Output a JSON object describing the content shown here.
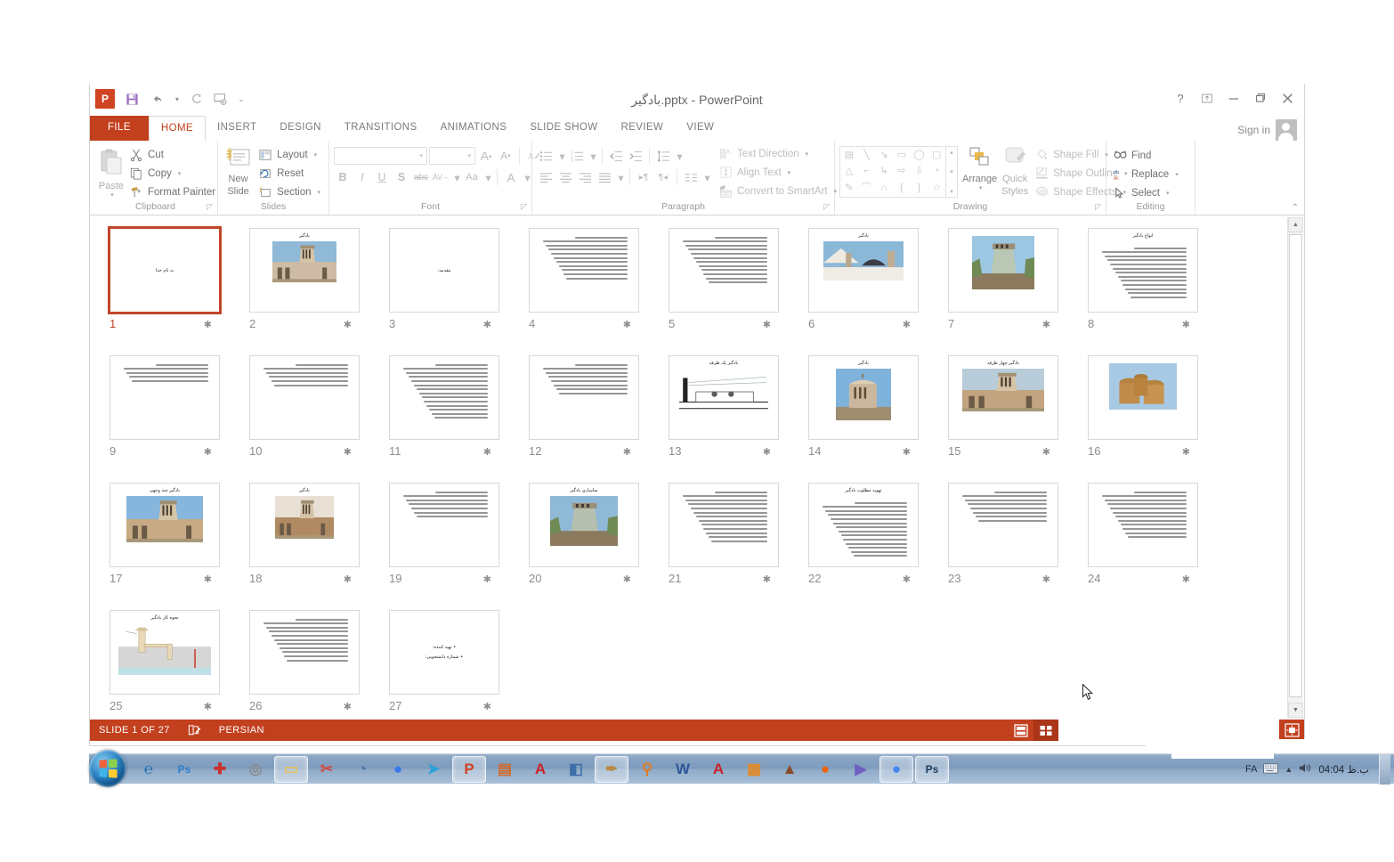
{
  "window": {
    "title": "بادگیر.pptx - PowerPoint",
    "qat": [
      {
        "name": "powerpoint-logo",
        "glyph": "P"
      },
      {
        "name": "save-icon",
        "glyph": "ὋE"
      },
      {
        "name": "undo-icon",
        "glyph": "↶"
      },
      {
        "name": "redo-icon",
        "glyph": "↻"
      },
      {
        "name": "start-slideshow-icon",
        "glyph": "▷"
      },
      {
        "name": "customize-qat-icon",
        "glyph": "≡"
      }
    ],
    "controls": {
      "help": "?",
      "ribbon_display": "⤒",
      "minimize": "—",
      "restore": "❐",
      "close": "✕"
    },
    "signin": "Sign in"
  },
  "tabs": [
    {
      "label": "FILE",
      "state": "file"
    },
    {
      "label": "HOME",
      "state": "active"
    },
    {
      "label": "INSERT",
      "state": "normal"
    },
    {
      "label": "DESIGN",
      "state": "normal"
    },
    {
      "label": "TRANSITIONS",
      "state": "normal"
    },
    {
      "label": "ANIMATIONS",
      "state": "normal"
    },
    {
      "label": "SLIDE SHOW",
      "state": "normal"
    },
    {
      "label": "REVIEW",
      "state": "normal"
    },
    {
      "label": "VIEW",
      "state": "normal"
    }
  ],
  "ribbon": {
    "groups": [
      {
        "name": "Clipboard",
        "label": "Clipboard",
        "big": {
          "label_line1": "Paste",
          "label_line2": "",
          "icon": "paste-icon",
          "disabled": true
        },
        "items": [
          {
            "label": "Cut",
            "icon": "cut-icon",
            "disabled": false,
            "caret": false
          },
          {
            "label": "Copy",
            "icon": "copy-icon",
            "disabled": false,
            "caret": true
          },
          {
            "label": "Format Painter",
            "icon": "format-painter-icon",
            "disabled": false,
            "caret": false
          }
        ]
      },
      {
        "name": "Slides",
        "label": "Slides",
        "big": {
          "label_line1": "New",
          "label_line2": "Slide",
          "icon": "new-slide-icon",
          "disabled": false
        },
        "items": [
          {
            "label": "Layout",
            "icon": "layout-icon",
            "disabled": false,
            "caret": true
          },
          {
            "label": "Reset",
            "icon": "reset-icon",
            "disabled": false,
            "caret": false
          },
          {
            "label": "Section",
            "icon": "section-icon",
            "disabled": false,
            "caret": true
          }
        ]
      },
      {
        "name": "Font",
        "label": "Font",
        "font_name": "",
        "font_size": "",
        "buttons": [
          "B",
          "I",
          "U",
          "S",
          "abc",
          "AV",
          "Aa",
          "A"
        ]
      },
      {
        "name": "Paragraph",
        "label": "Paragraph",
        "items": [
          {
            "label": "Text Direction",
            "icon": "text-direction-icon",
            "caret": true
          },
          {
            "label": "Align Text",
            "icon": "align-text-icon",
            "caret": true
          },
          {
            "label": "Convert to SmartArt",
            "icon": "convert-smartart-icon",
            "caret": true
          }
        ]
      },
      {
        "name": "Drawing",
        "label": "Drawing",
        "arrange": "Arrange",
        "quick_styles_line1": "Quick",
        "quick_styles_line2": "Styles",
        "items": [
          {
            "label": "Shape Fill",
            "icon": "shape-fill-icon",
            "caret": true
          },
          {
            "label": "Shape Outline",
            "icon": "shape-outline-icon",
            "caret": true
          },
          {
            "label": "Shape Effects",
            "icon": "shape-effects-icon",
            "caret": true
          }
        ]
      },
      {
        "name": "Editing",
        "label": "Editing",
        "items": [
          {
            "label": "Find",
            "icon": "find-icon",
            "caret": false
          },
          {
            "label": "Replace",
            "icon": "replace-icon",
            "caret": true
          },
          {
            "label": "Select",
            "icon": "select-icon",
            "caret": true
          }
        ]
      }
    ],
    "collapse_icon": "⌃"
  },
  "slides": [
    {
      "n": "1",
      "kind": "center",
      "title": "به نام خدا",
      "selected": true
    },
    {
      "n": "2",
      "kind": "title-image",
      "title": "بادگیر",
      "image": "badgir-courtyard"
    },
    {
      "n": "3",
      "kind": "center",
      "title": "مقدمه:"
    },
    {
      "n": "4",
      "kind": "text",
      "lines": 11
    },
    {
      "n": "5",
      "kind": "text",
      "lines": 12
    },
    {
      "n": "6",
      "kind": "title-image",
      "title": "بادگیر",
      "image": "badgir-domes"
    },
    {
      "n": "7",
      "kind": "image",
      "image": "badgir-tower-green"
    },
    {
      "n": "8",
      "kind": "title-text",
      "title": "انواع بادگیر",
      "lines": 13
    },
    {
      "n": "9",
      "kind": "text",
      "lines": 5
    },
    {
      "n": "10",
      "kind": "text",
      "lines": 6
    },
    {
      "n": "11",
      "kind": "text",
      "lines": 14
    },
    {
      "n": "12",
      "kind": "text",
      "lines": 8
    },
    {
      "n": "13",
      "kind": "title-image",
      "title": "بادگیر یک طرفه",
      "image": "badgir-section-diagram"
    },
    {
      "n": "14",
      "kind": "title-image",
      "title": "بادگیر",
      "image": "badgir-round-tower"
    },
    {
      "n": "15",
      "kind": "title-image",
      "title": "بادگیر چهار طرفه",
      "image": "badgir-four-sided"
    },
    {
      "n": "16",
      "kind": "image",
      "image": "badgir-clay-pipes"
    },
    {
      "n": "17",
      "kind": "title-image",
      "title": "بادگیر چند وجهی",
      "image": "badgir-dowlatabad"
    },
    {
      "n": "18",
      "kind": "title-image",
      "title": "بادگیر",
      "image": "badgir-brick-mosque"
    },
    {
      "n": "19",
      "kind": "text",
      "lines": 7
    },
    {
      "n": "20",
      "kind": "title-image",
      "title": "نماسازی بادگیر",
      "image": "badgir-facade"
    },
    {
      "n": "21",
      "kind": "text",
      "lines": 13
    },
    {
      "n": "22",
      "kind": "title-text",
      "title": "تهویه مطلوب بادگیر",
      "lines": 14
    },
    {
      "n": "23",
      "kind": "text",
      "lines": 8
    },
    {
      "n": "24",
      "kind": "text",
      "lines": 12
    },
    {
      "n": "25",
      "kind": "title-image",
      "title": "نحوه کار بادگیر",
      "image": "badgir-working-diagram"
    },
    {
      "n": "26",
      "kind": "text",
      "lines": 11
    },
    {
      "n": "27",
      "kind": "bullets",
      "bullet1": "تهیه کننده:",
      "bullet2": "شماره دانشجویی:"
    }
  ],
  "statusbar": {
    "slide_counter": "SLIDE 1 OF 27",
    "notes_icon": "notes-icon",
    "language": "PERSIAN",
    "views": [
      {
        "name": "normal-view-button",
        "active": false
      },
      {
        "name": "slide-sorter-view-button",
        "active": true
      }
    ],
    "fit_to_window": "fit-slide-to-window-button"
  },
  "taskbar": {
    "start": "windows-start-orb",
    "items": [
      {
        "name": "internet-explorer",
        "glyph": "℮",
        "color": "#1c6fb5",
        "active": false
      },
      {
        "name": "photoshop-cs",
        "glyph": "Ps",
        "color": "#2f7fd0",
        "active": false
      },
      {
        "name": "pdf-add-tool",
        "glyph": "✚",
        "color": "#c9322d",
        "active": false
      },
      {
        "name": "camera-tool",
        "glyph": "◎",
        "color": "#8b8b8b",
        "active": false
      },
      {
        "name": "windows-explorer",
        "glyph": "▭",
        "color": "#e9bf5d",
        "active": true
      },
      {
        "name": "snipping-tool",
        "glyph": "✂",
        "color": "#d24a3a",
        "active": false
      },
      {
        "name": "nero-burner",
        "glyph": "◔",
        "color": "#4a6fa5",
        "active": false
      },
      {
        "name": "chrome-secondary",
        "glyph": "●",
        "color": "#3b78e7",
        "active": false
      },
      {
        "name": "telegram",
        "glyph": "➤",
        "color": "#2a9fd6",
        "active": false
      },
      {
        "name": "powerpoint",
        "glyph": "P",
        "color": "#d04423",
        "active": true
      },
      {
        "name": "ppt-converter",
        "glyph": "▤",
        "color": "#d06a2a",
        "active": false
      },
      {
        "name": "adobe-reader",
        "glyph": "A",
        "color": "#cc2127",
        "active": false
      },
      {
        "name": "book-reader",
        "glyph": "◧",
        "color": "#3f6fa8",
        "active": false
      },
      {
        "name": "paint-brush-tool",
        "glyph": "✒",
        "color": "#b78a3c",
        "active": true
      },
      {
        "name": "search-everything",
        "glyph": "⚲",
        "color": "#e07b20",
        "active": false
      },
      {
        "name": "microsoft-word",
        "glyph": "W",
        "color": "#2b579a",
        "active": false
      },
      {
        "name": "autocad",
        "glyph": "A",
        "color": "#cc2127",
        "active": false
      },
      {
        "name": "pdf-editor",
        "glyph": "▦",
        "color": "#e08a2a",
        "active": false
      },
      {
        "name": "winrar",
        "glyph": "▲",
        "color": "#8a4a2a",
        "active": false
      },
      {
        "name": "firefox",
        "glyph": "●",
        "color": "#e8650f",
        "active": false
      },
      {
        "name": "media-player",
        "glyph": "▶",
        "color": "#6f5fc0",
        "active": false
      },
      {
        "name": "google-chrome",
        "glyph": "●",
        "color": "#4285f4",
        "active": true
      },
      {
        "name": "photoshop",
        "glyph": "Ps",
        "color": "#1c3d5c",
        "active": true
      }
    ],
    "tray": {
      "language": "FA",
      "keyboard_icon": "keyboard-icon",
      "show_hidden_icon": "▲",
      "volume_icon": "speaker-icon",
      "clock": "04:04 ب.ظ"
    }
  }
}
